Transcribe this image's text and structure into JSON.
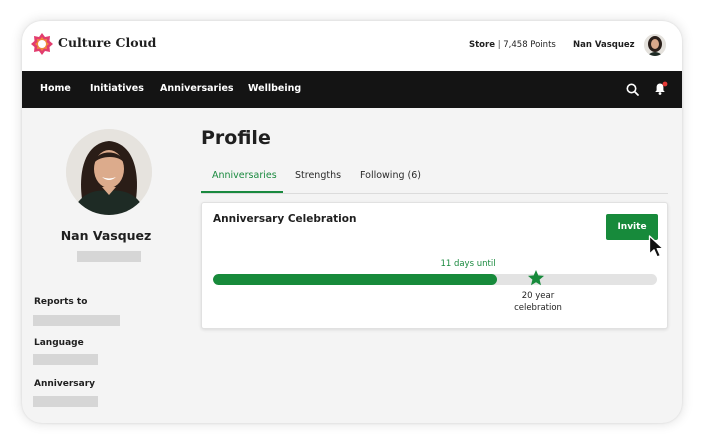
{
  "header": {
    "brand": "Culture Cloud",
    "store_label": "Store",
    "separator": "|",
    "points": "7,458 Points",
    "user_name": "Nan Vasquez"
  },
  "nav": {
    "items": [
      "Home",
      "Initiatives",
      "Anniversaries",
      "Wellbeing"
    ]
  },
  "profile": {
    "name": "Nan Vasquez",
    "fields": [
      "Reports to",
      "Language",
      "Anniversary"
    ]
  },
  "main": {
    "title": "Profile",
    "tabs": [
      "Anniversaries",
      "Strengths",
      "Following (6)"
    ],
    "active_tab": "Anniversaries"
  },
  "card": {
    "title": "Anniversary Celebration",
    "invite_label": "Invite",
    "days_until": "11 days until",
    "progress": 0.64,
    "milestone_line1": "20 year",
    "milestone_line2": "celebration"
  },
  "colors": {
    "accent": "#178a3b",
    "nav_bg": "#141414",
    "notification_dot": "#e53935"
  },
  "icons": {
    "logo": "culture-cloud-flower-icon",
    "search": "search-icon",
    "bell": "bell-icon",
    "star": "star-icon",
    "cursor": "mouse-cursor-icon"
  }
}
